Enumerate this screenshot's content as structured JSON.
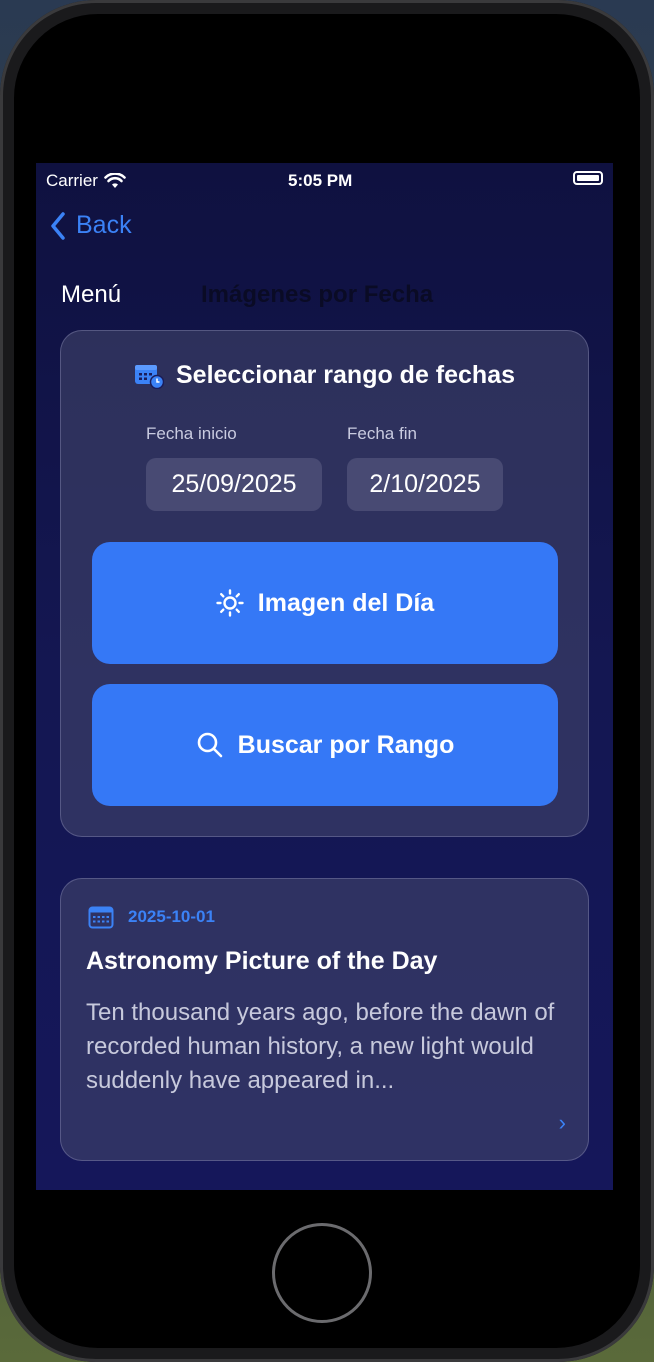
{
  "status_bar": {
    "carrier": "Carrier",
    "time": "5:05 PM"
  },
  "nav": {
    "back_label": "Back",
    "menu_label": "Menú",
    "title": "Imágenes por Fecha"
  },
  "filter": {
    "header": "Seleccionar rango de fechas",
    "start_label": "Fecha inicio",
    "start_value": "25/09/2025",
    "end_label": "Fecha fin",
    "end_value": "2/10/2025",
    "today_button": "Imagen del Día",
    "range_button": "Buscar por Rango"
  },
  "results": [
    {
      "date": "2025-10-01",
      "title": "Astronomy Picture of the Day",
      "description": "Ten thousand years ago, before the dawn of recorded human history, a new light would suddenly have appeared in..."
    }
  ],
  "colors": {
    "accent": "#3578f6",
    "background": "#141752",
    "card": "#3a3c6a"
  },
  "icons": [
    "wifi-icon",
    "battery-icon",
    "chevron-left-icon",
    "calendar-clock-icon",
    "sun-icon",
    "search-icon",
    "calendar-icon",
    "chevron-right-icon"
  ]
}
